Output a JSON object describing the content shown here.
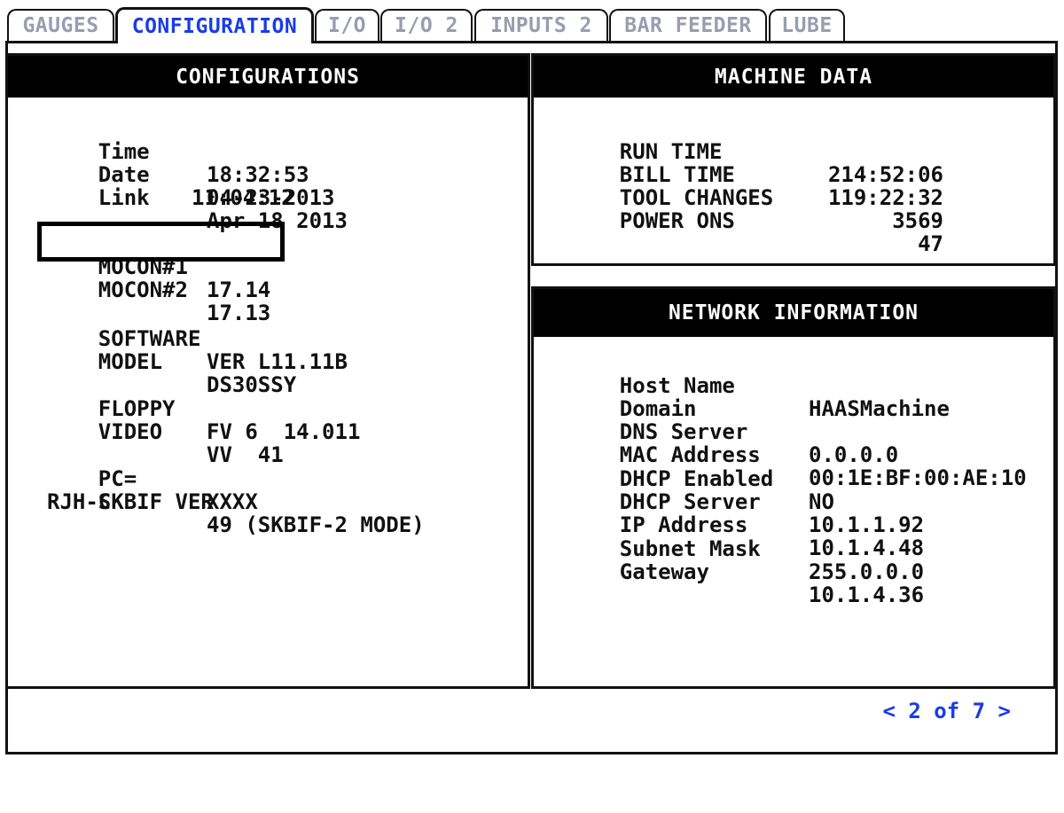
{
  "tabs": [
    {
      "label": "GAUGES",
      "active": false
    },
    {
      "label": "CONFIGURATION",
      "active": true
    },
    {
      "label": "I/O",
      "active": false
    },
    {
      "label": "I/O 2",
      "active": false
    },
    {
      "label": "INPUTS 2",
      "active": false
    },
    {
      "label": "BAR FEEDER",
      "active": false
    },
    {
      "label": "LUBE",
      "active": false
    }
  ],
  "configurations": {
    "title": "CONFIGURATIONS",
    "time_label": "Time",
    "time_value": "18:32:53",
    "date_label": "Date",
    "date_value": "04-23-2013",
    "link_label": "Link",
    "link_value": "Apr 18 2013",
    "link_time": "11:04:12",
    "mocon1_label": "MOCON#1",
    "mocon1_value": "17.14",
    "mocon2_label": "MOCON#2",
    "mocon2_value": "17.13",
    "software_label": "SOFTWARE",
    "software_value": "VER L11.11B",
    "model_label": "MODEL",
    "model_value": "DS30SSY",
    "floppy_label": "FLOPPY",
    "floppy_value": "FV 6  14.011",
    "video_label": "VIDEO",
    "video_value": "VV  41",
    "pc_label": "PC=",
    "pc_value": "XXXX",
    "skbif_label": "SKBIF VER",
    "skbif_value": "49 (SKBIF-2 MODE)",
    "rjh_label": "RJH-C"
  },
  "machine_data": {
    "title": "MACHINE DATA",
    "rows": [
      {
        "label": "RUN TIME",
        "value": "214:52:06"
      },
      {
        "label": "BILL TIME",
        "value": "119:22:32"
      },
      {
        "label": "TOOL CHANGES",
        "value": "3569"
      },
      {
        "label": "POWER ONS",
        "value": "47"
      }
    ]
  },
  "network": {
    "title": "NETWORK INFORMATION",
    "rows": [
      {
        "label": "Host Name",
        "value": "HAASMachine"
      },
      {
        "label": "Domain",
        "value": ""
      },
      {
        "label": "DNS Server",
        "value": "0.0.0.0"
      },
      {
        "label": "MAC Address",
        "value": "00:1E:BF:00:AE:10"
      },
      {
        "label": "DHCP Enabled",
        "value": "NO"
      },
      {
        "label": "DHCP Server",
        "value": "10.1.1.92"
      },
      {
        "label": "IP Address",
        "value": "10.1.4.48"
      },
      {
        "label": "Subnet Mask",
        "value": "255.0.0.0"
      },
      {
        "label": "Gateway",
        "value": "10.1.4.36"
      }
    ]
  },
  "pager": {
    "text": "< 2 of 7 >"
  }
}
